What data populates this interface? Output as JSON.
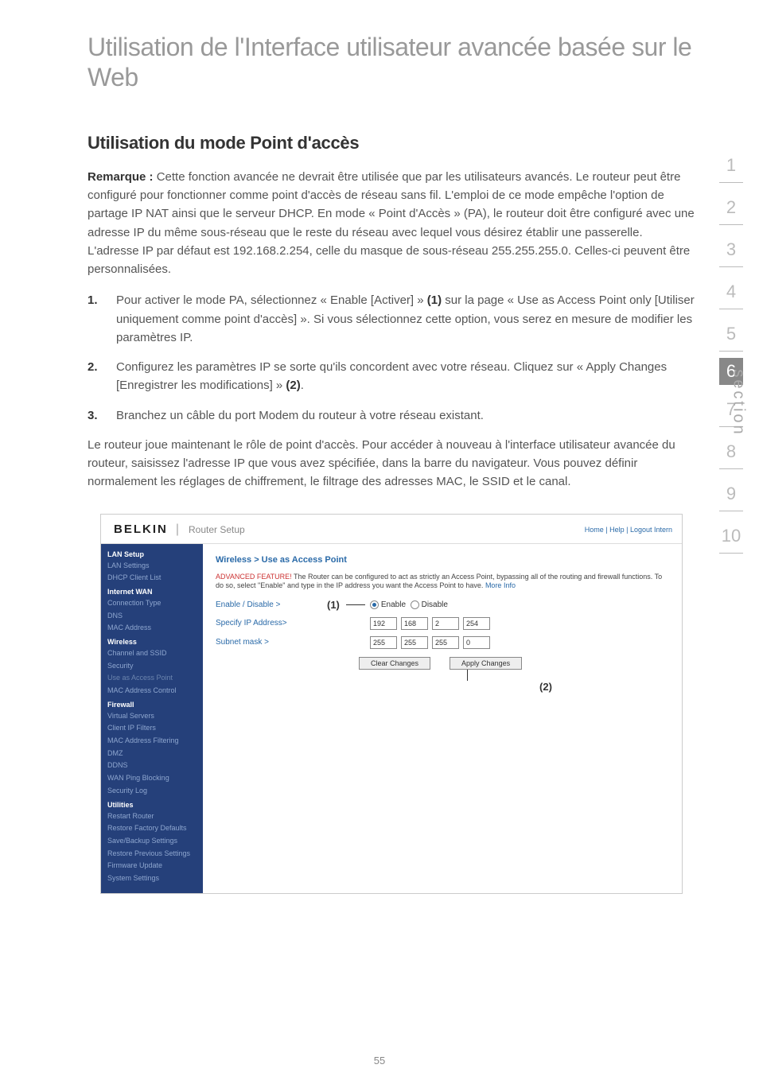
{
  "doc": {
    "title": "Utilisation de l'Interface utilisateur avancée basée sur le Web",
    "heading": "Utilisation du mode Point d'accès",
    "note_lead": "Remarque :",
    "note_body": " Cette fonction avancée ne devrait être utilisée que par les utilisateurs avancés. Le routeur peut être configuré pour fonctionner comme point d'accès de réseau sans fil. L'emploi de ce mode empêche l'option de partage IP NAT ainsi que le serveur DHCP. En mode « Point d'Accès » (PA), le routeur doit être configuré avec une adresse IP du même sous-réseau que le reste du réseau avec lequel vous désirez établir une passerelle. L'adresse IP par défaut est 192.168.2.254, celle du masque de sous-réseau 255.255.255.0. Celles-ci peuvent être personnalisées.",
    "steps": [
      {
        "n": "1.",
        "pre": "Pour activer le mode PA, sélectionnez « Enable [Activer] » ",
        "bold": "(1)",
        "post": " sur la page « Use as Access Point only [Utiliser uniquement comme point d'accès] ». Si vous sélectionnez cette option, vous serez en mesure de modifier les paramètres IP."
      },
      {
        "n": "2.",
        "pre": "Configurez les paramètres IP se sorte qu'ils concordent avec votre réseau. Cliquez sur « Apply Changes [Enregistrer les modifications] » ",
        "bold": "(2)",
        "post": "."
      },
      {
        "n": "3.",
        "pre": "Branchez un câble du port Modem du routeur à votre réseau existant.",
        "bold": "",
        "post": ""
      }
    ],
    "closing": "Le routeur joue maintenant le rôle de point d'accès. Pour accéder à nouveau à l'interface utilisateur avancée du routeur, saisissez l'adresse IP que vous avez spécifiée, dans la barre du navigateur. Vous pouvez définir normalement les réglages de chiffrement, le filtrage des adresses MAC, le SSID et le canal.",
    "page_number": "55"
  },
  "sidestrip": {
    "label": "section",
    "items": [
      "1",
      "2",
      "3",
      "4",
      "5",
      "6",
      "7",
      "8",
      "9",
      "10"
    ],
    "active_index": 5
  },
  "router": {
    "brand": "BELKIN",
    "setup": "Router Setup",
    "toplinks": "Home | Help | Logout   Intern",
    "sidebar": {
      "groups": [
        {
          "title": "LAN Setup",
          "items": [
            "LAN Settings",
            "DHCP Client List"
          ]
        },
        {
          "title": "Internet WAN",
          "items": [
            "Connection Type",
            "DNS",
            "MAC Address"
          ]
        },
        {
          "title": "Wireless",
          "items": [
            "Channel and SSID",
            "Security",
            "Use as Access Point",
            "MAC Address Control"
          ]
        },
        {
          "title": "Firewall",
          "items": [
            "Virtual Servers",
            "Client IP Filters",
            "MAC Address Filtering",
            "DMZ",
            "DDNS",
            "WAN Ping Blocking",
            "Security Log"
          ]
        },
        {
          "title": "Utilities",
          "items": [
            "Restart Router",
            "Restore Factory Defaults",
            "Save/Backup Settings",
            "Restore Previous Settings",
            "Firmware Update",
            "System Settings"
          ]
        }
      ]
    },
    "main": {
      "breadcrumb": "Wireless > Use as Access Point",
      "adv_lead": "ADVANCED FEATURE!",
      "adv_body": " The Router can be configured to act as strictly an Access Point, bypassing all of the routing and firewall functions. To do so, select \"Enable\" and type in the IP address you want the Access Point to have. ",
      "adv_more": "More Info",
      "row_enable_label": "Enable / Disable >",
      "callout1": "(1)",
      "radio_enable": "Enable",
      "radio_disable": "Disable",
      "row_ip_label": "Specify IP Address>",
      "ip": [
        "192",
        "168",
        "2",
        "254"
      ],
      "row_mask_label": "Subnet mask >",
      "mask": [
        "255",
        "255",
        "255",
        "0"
      ],
      "btn_clear": "Clear Changes",
      "btn_apply": "Apply Changes",
      "callout2": "(2)"
    }
  }
}
